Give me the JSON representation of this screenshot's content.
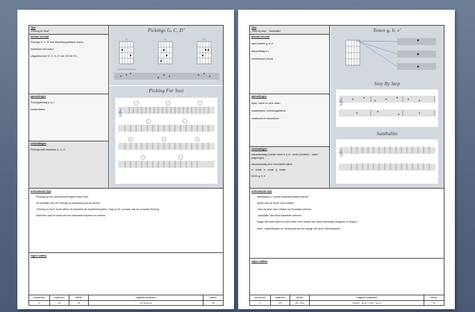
{
  "page1": {
    "titel": "Titel",
    "titel_value": "„Picking for Susi”",
    "nieuwe_leerstof": "nieuwe leerstof",
    "items": [
      "Pickings G, C, D’ met wisselbas(arbitaire noten)",
      "basstrand met stok p",
      "slagpatroon(en G, C, D, D’ (zie CD dir V1)"
    ],
    "aanvullingen": "aanvullingen",
    "aanv_items": [
      "Pickingwerking p i p i",
      "basisnotaties"
    ],
    "voorbereidingen": "verbindingen",
    "vb_items": [
      "Pickings met wisselbas G, C, D"
    ],
    "header1": "Pickings G, C, D’",
    "chords": [
      "G",
      "C",
      "D7"
    ],
    "header2": "Picking For Susi",
    "method_head": "methodische tips",
    "method_items": [
      "Pickings op het doorlopende/ergens halen door",
      "dit omvatten van de Pickings op aanwijzing van de docent",
      "„Picking for Susi” wordt alleen de basstand als bearbeide spelen, il ligt op de -g snaar, dan de complete Picking",
      "afdeelden aan de hand van het notenbeeld bepalen en noteren"
    ],
    "notities": "eigen notities",
    "foot_head": [
      "lesnummer",
      "maatsoort",
      "CD Nr.",
      "volgende onderwerp",
      "CD bis"
    ],
    "foot_row": [
      "G",
      "4/4",
      "04",
      "„Oh Susanna”",
      "28"
    ],
    "pnum": "5"
  },
  "page2": {
    "titel": "Titel",
    "titel_value": "„Step by step”, „Sambalito”",
    "nieuwe_leerstof": "nieuwe leerstof",
    "items": [
      "open snaren g, b, e’",
      "akkoordslag m i",
      "wisseldespel (Duet)"
    ],
    "aanvullingen": "aanvullingen",
    "aanv_items": [
      "apart, halve en hele noten",
      "maatstrepen, herhalingstekens",
      "maatsoort en tussenpunt"
    ],
    "voorbereidingen": "verbindingen",
    "vb_items": [
      "wisselaanslag (rechter hand m i) m - rondo (middel) i - index (wijsvinger)",
      "wisselaanslag door woordeelle zijlinn"
    ],
    "string_labels": [
      "e’ - snaar",
      "b - snaar",
      "g - snaar"
    ],
    "tonen": "tonen g, b, e’",
    "header1": "Tonen g, b, e’",
    "header2": "Step By Step",
    "header3": "Sambalito",
    "method_head": "methodische tips",
    "method_items": [
      "wisselslag m i zonder ansprassending oefenen",
      "spelen van de tonen door imitatie",
      "„Step by step” door middel van Toonplay oefenen",
      "„Sambalito” als ritme-wisselede oefenen",
      "begijp van basti halve en hele noten door middel van ritme-oefeningen (Klappen of Zingen)",
      "ritme - wisselklinspel ter verdieping van het begrijp van deze notenwaarden"
    ],
    "notities": "eigen notities",
    "foot_head": [
      "lesnummer",
      "maatsoort",
      "CD Nr.",
      "volgende onderwerp",
      "CD bis"
    ],
    "foot_row": [
      "G",
      "4/4",
      "CD + 9/10",
      "„Classic”, „Rock 'n' Roll”, Toon a",
      "70"
    ],
    "pnum": "6"
  }
}
